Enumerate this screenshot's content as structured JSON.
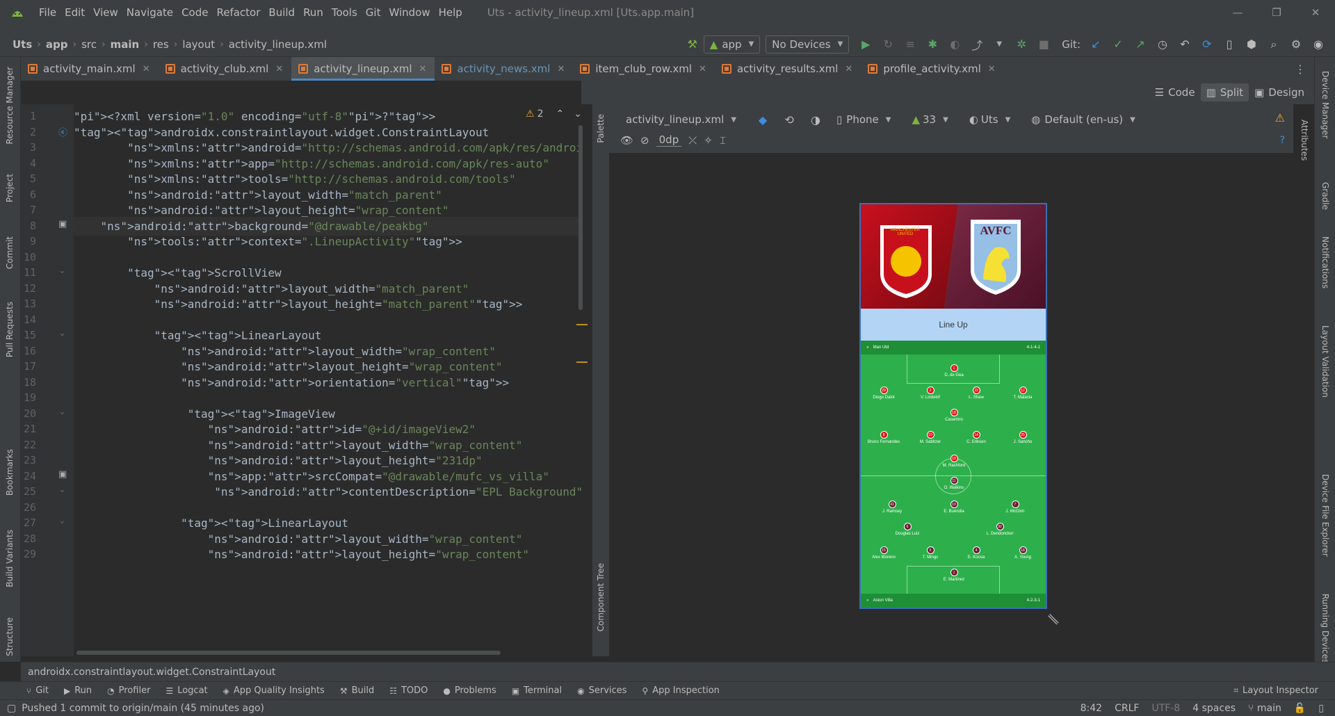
{
  "menubar": {
    "items": [
      "File",
      "Edit",
      "View",
      "Navigate",
      "Code",
      "Refactor",
      "Build",
      "Run",
      "Tools",
      "Git",
      "Window",
      "Help"
    ],
    "window_title": "Uts - activity_lineup.xml [Uts.app.main]"
  },
  "navbar": {
    "crumbs": [
      "Uts",
      "app",
      "src",
      "main",
      "res",
      "layout",
      "activity_lineup.xml"
    ],
    "run_config": "app",
    "device": "No Devices",
    "git_label": "Git:"
  },
  "tabs": [
    {
      "label": "activity_main.xml"
    },
    {
      "label": "activity_club.xml"
    },
    {
      "label": "activity_lineup.xml"
    },
    {
      "label": "activity_news.xml"
    },
    {
      "label": "item_club_row.xml"
    },
    {
      "label": "activity_results.xml"
    },
    {
      "label": "profile_activity.xml"
    }
  ],
  "view_modes": {
    "code": "Code",
    "split": "Split",
    "design": "Design"
  },
  "editor": {
    "warning_count": "2",
    "lines": [
      {
        "n": "1"
      },
      {
        "n": "2"
      },
      {
        "n": "3"
      },
      {
        "n": "4"
      },
      {
        "n": "5"
      },
      {
        "n": "6"
      },
      {
        "n": "7"
      },
      {
        "n": "8"
      },
      {
        "n": "9"
      },
      {
        "n": "10"
      },
      {
        "n": "11"
      },
      {
        "n": "12"
      },
      {
        "n": "13"
      },
      {
        "n": "14"
      },
      {
        "n": "15"
      },
      {
        "n": "16"
      },
      {
        "n": "17"
      },
      {
        "n": "18"
      },
      {
        "n": "19"
      },
      {
        "n": "20"
      },
      {
        "n": "21"
      },
      {
        "n": "22"
      },
      {
        "n": "23"
      },
      {
        "n": "24"
      },
      {
        "n": "25"
      },
      {
        "n": "26"
      },
      {
        "n": "27"
      },
      {
        "n": "28"
      },
      {
        "n": "29"
      }
    ],
    "code": [
      "<?xml version=\"1.0\" encoding=\"utf-8\"?>",
      "<androidx.constraintlayout.widget.ConstraintLayout",
      "        xmlns:android=\"http://schemas.android.com/apk/res/android\"",
      "        xmlns:app=\"http://schemas.android.com/apk/res-auto\"",
      "        xmlns:tools=\"http://schemas.android.com/tools\"",
      "        android:layout_width=\"match_parent\"",
      "        android:layout_height=\"wrap_content\"",
      "    android:background=\"@drawable/peakbg\"",
      "        tools:context=\".LineupActivity\">",
      "",
      "        <ScrollView",
      "            android:layout_width=\"match_parent\"",
      "            android:layout_height=\"match_parent\">",
      "",
      "            <LinearLayout",
      "                android:layout_width=\"wrap_content\"",
      "                android:layout_height=\"wrap_content\"",
      "                android:orientation=\"vertical\">",
      "",
      "                 <ImageView",
      "                    android:id=\"@+id/imageView2\"",
      "                    android:layout_width=\"wrap_content\"",
      "                    android:layout_height=\"231dp\"",
      "                    app:srcCompat=\"@drawable/mufc_vs_villa\"",
      "                     android:contentDescription=\"EPL Background\" />",
      "",
      "                <LinearLayout",
      "                    android:layout_width=\"wrap_content\"",
      "                    android:layout_height=\"wrap_content\""
    ]
  },
  "design": {
    "file_combo": "activity_lineup.xml",
    "phone_combo": "Phone",
    "api_combo": "33",
    "theme_combo": "Uts",
    "locale_combo": "Default (en-us)",
    "margin_value": "0dp",
    "palette_label": "Palette",
    "component_tree_label": "Component Tree",
    "phone_screen": {
      "home_badge": "MANCHESTER UNITED",
      "away_badge": "AVFC",
      "lineup_title": "Line Up",
      "home_team": {
        "name": "Man Utd",
        "formation": "4-1-4-1"
      },
      "away_team": {
        "name": "Aston Villa",
        "formation": "4-2-3-1"
      },
      "home_players": [
        {
          "num": "1",
          "name": "D. de Gea"
        },
        {
          "num": "29",
          "name": "Diogo Dalot"
        },
        {
          "num": "2",
          "name": "V. Lindelof"
        },
        {
          "num": "23",
          "name": "L. Shaw"
        },
        {
          "num": "12",
          "name": "T. Malacia"
        },
        {
          "num": "18",
          "name": "Casemiro"
        },
        {
          "num": "8",
          "name": "Bruno Fernandes"
        },
        {
          "num": "10",
          "name": "M. Sabitzer"
        },
        {
          "num": "14",
          "name": "C. Eriksen"
        },
        {
          "num": "25",
          "name": "J. Sancho"
        },
        {
          "num": "10",
          "name": "M. Rashford"
        }
      ],
      "away_players": [
        {
          "num": "11",
          "name": "O. Watkins"
        },
        {
          "num": "41",
          "name": "J. Ramsey"
        },
        {
          "num": "10",
          "name": "E. Buendia"
        },
        {
          "num": "7",
          "name": "J. McGinn"
        },
        {
          "num": "6",
          "name": "Douglas Luiz"
        },
        {
          "num": "32",
          "name": "L. Dendoncker"
        },
        {
          "num": "15",
          "name": "Alex Moreno"
        },
        {
          "num": "5",
          "name": "T. Mings"
        },
        {
          "num": "4",
          "name": "E. Konsa"
        },
        {
          "num": "18",
          "name": "A. Young"
        },
        {
          "num": "1",
          "name": "E. Martinez"
        }
      ]
    }
  },
  "left_strip": [
    "Resource Manager",
    "Project",
    "Commit",
    "Pull Requests",
    "Bookmarks",
    "Build Variants",
    "Structure"
  ],
  "right_strip": [
    "Device Manager",
    "Attributes",
    "Gradle",
    "Notifications",
    "Layout Validation",
    "Device File Explorer",
    "Running Devices"
  ],
  "breadcrumb_bar": "androidx.constraintlayout.widget.ConstraintLayout",
  "bottom_tools": [
    "Git",
    "Run",
    "Profiler",
    "Logcat",
    "App Quality Insights",
    "Build",
    "TODO",
    "Problems",
    "Terminal",
    "Services",
    "App Inspection"
  ],
  "layout_inspector": "Layout Inspector",
  "status": {
    "message": "Pushed 1 commit to origin/main (45 minutes ago)",
    "position": "8:42",
    "line_sep": "CRLF",
    "encoding": "UTF-8",
    "indent": "4 spaces",
    "branch": "main"
  }
}
